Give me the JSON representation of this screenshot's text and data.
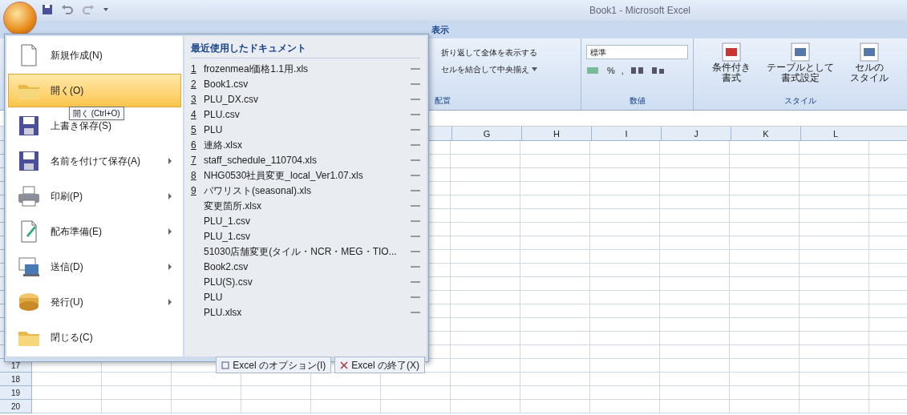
{
  "window": {
    "title": "Book1 - Microsoft Excel"
  },
  "ribbon": {
    "tab": "表示",
    "alignment_group": {
      "wrap_text": "折り返して全体を表示する",
      "merge_center": "セルを結合して中央揃え",
      "label": "配置"
    },
    "number_group": {
      "format": "標準",
      "percent": "%",
      "comma": ",",
      "label": "数値"
    },
    "styles_group": {
      "buttons": [
        {
          "line1": "条件付き",
          "line2": "書式"
        },
        {
          "line1": "テーブルとして",
          "line2": "書式設定"
        },
        {
          "line1": "セルの",
          "line2": "スタイル"
        }
      ],
      "label": "スタイル"
    }
  },
  "office_menu": {
    "items": [
      {
        "label": "新規作成(N)",
        "submenu": false,
        "selected": false
      },
      {
        "label": "開く(O)",
        "submenu": false,
        "selected": true
      },
      {
        "label": "上書き保存(S)",
        "submenu": false,
        "selected": false
      },
      {
        "label": "名前を付けて保存(A)",
        "submenu": true,
        "selected": false
      },
      {
        "label": "印刷(P)",
        "submenu": true,
        "selected": false
      },
      {
        "label": "配布準備(E)",
        "submenu": true,
        "selected": false
      },
      {
        "label": "送信(D)",
        "submenu": true,
        "selected": false
      },
      {
        "label": "発行(U)",
        "submenu": true,
        "selected": false
      },
      {
        "label": "閉じる(C)",
        "submenu": false,
        "selected": false
      }
    ],
    "tooltip": "開く (Ctrl+O)",
    "recent": {
      "heading": "最近使用したドキュメント",
      "items": [
        {
          "number": "1",
          "name": "frozenmeal価格1.1用.xls"
        },
        {
          "number": "2",
          "name": "Book1.csv"
        },
        {
          "number": "3",
          "name": "PLU_DX.csv"
        },
        {
          "number": "4",
          "name": "PLU.csv"
        },
        {
          "number": "5",
          "name": "PLU"
        },
        {
          "number": "6",
          "name": "連絡.xlsx"
        },
        {
          "number": "7",
          "name": "staff_schedule_110704.xls"
        },
        {
          "number": "8",
          "name": "NHG0530社員変更_local_Ver1.07.xls"
        },
        {
          "number": "9",
          "name": "パワリスト(seasonal).xls"
        },
        {
          "name": "変更箇所.xlsx"
        },
        {
          "name": "PLU_1.csv"
        },
        {
          "name": "PLU_1.csv"
        },
        {
          "name": "51030店舗変更(タイル・NCR・MEG・TIO..."
        },
        {
          "name": "Book2.csv"
        },
        {
          "name": "PLU(S).csv"
        },
        {
          "name": "PLU"
        },
        {
          "name": "PLU.xlsx"
        }
      ]
    },
    "footer_buttons": [
      "Excel のオプション(I)",
      "Excel の終了(X)"
    ]
  },
  "sheet": {
    "columns": [
      "G",
      "H",
      "I",
      "J",
      "K",
      "L"
    ],
    "rows": [
      "17",
      "18",
      "19",
      "20"
    ]
  }
}
